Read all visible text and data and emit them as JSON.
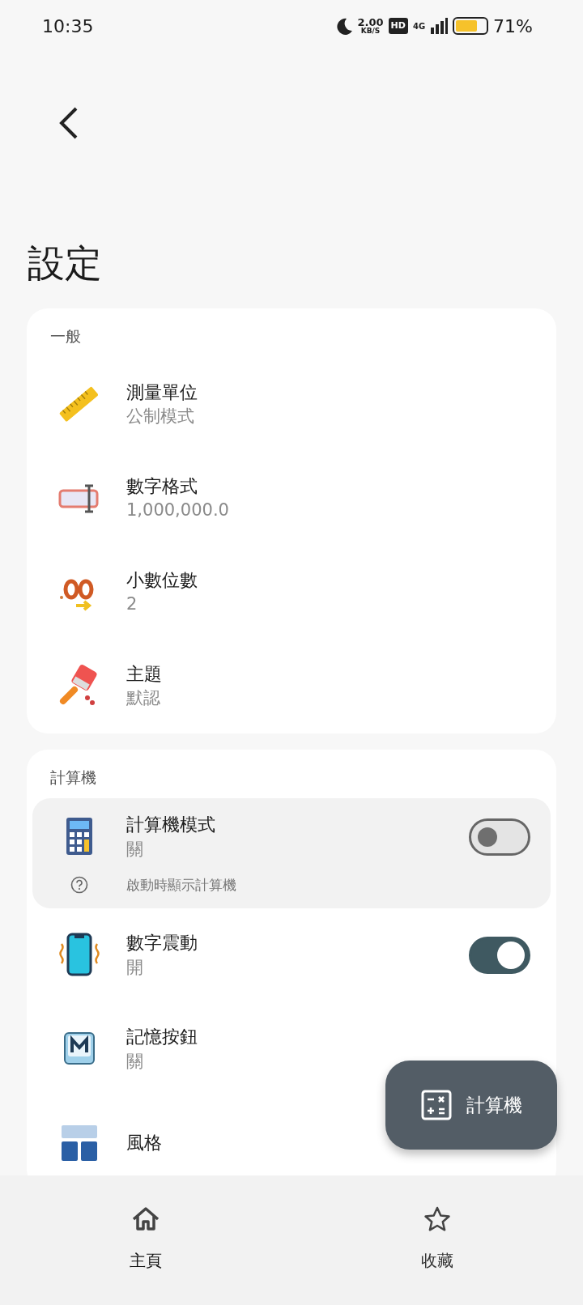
{
  "status_bar": {
    "time": "10:35",
    "net_speed": "2.00",
    "net_unit": "KB/S",
    "hd": "HD",
    "network": "4G",
    "battery": "71%"
  },
  "header": {
    "title": "設定"
  },
  "sections": [
    {
      "label": "一般",
      "rows": [
        {
          "kind": "plain",
          "title": "測量單位",
          "value": "公制模式",
          "selected": false
        },
        {
          "kind": "plain",
          "title": "數字格式",
          "value": "1,000,000.0",
          "selected": false
        },
        {
          "kind": "plain",
          "title": "小數位數",
          "value": "2",
          "selected": false
        },
        {
          "kind": "plain",
          "title": "主題",
          "value": "默認",
          "selected": false
        }
      ]
    },
    {
      "label": "計算機",
      "rows": [
        {
          "kind": "toggle",
          "title": "計算機模式",
          "value": "關",
          "on": false,
          "selected": true,
          "hint": "啟動時顯示計算機"
        },
        {
          "kind": "toggle",
          "title": "數字震動",
          "value": "開",
          "on": true,
          "selected": false
        },
        {
          "kind": "plain",
          "title": "記憶按鈕",
          "value": "關",
          "selected": false
        },
        {
          "kind": "plain",
          "title": "風格",
          "selected": false
        }
      ]
    }
  ],
  "fab": {
    "label": "計算機"
  },
  "bottom_nav": [
    {
      "label": "主頁",
      "selected": true
    },
    {
      "label": "收藏",
      "selected": false
    }
  ]
}
